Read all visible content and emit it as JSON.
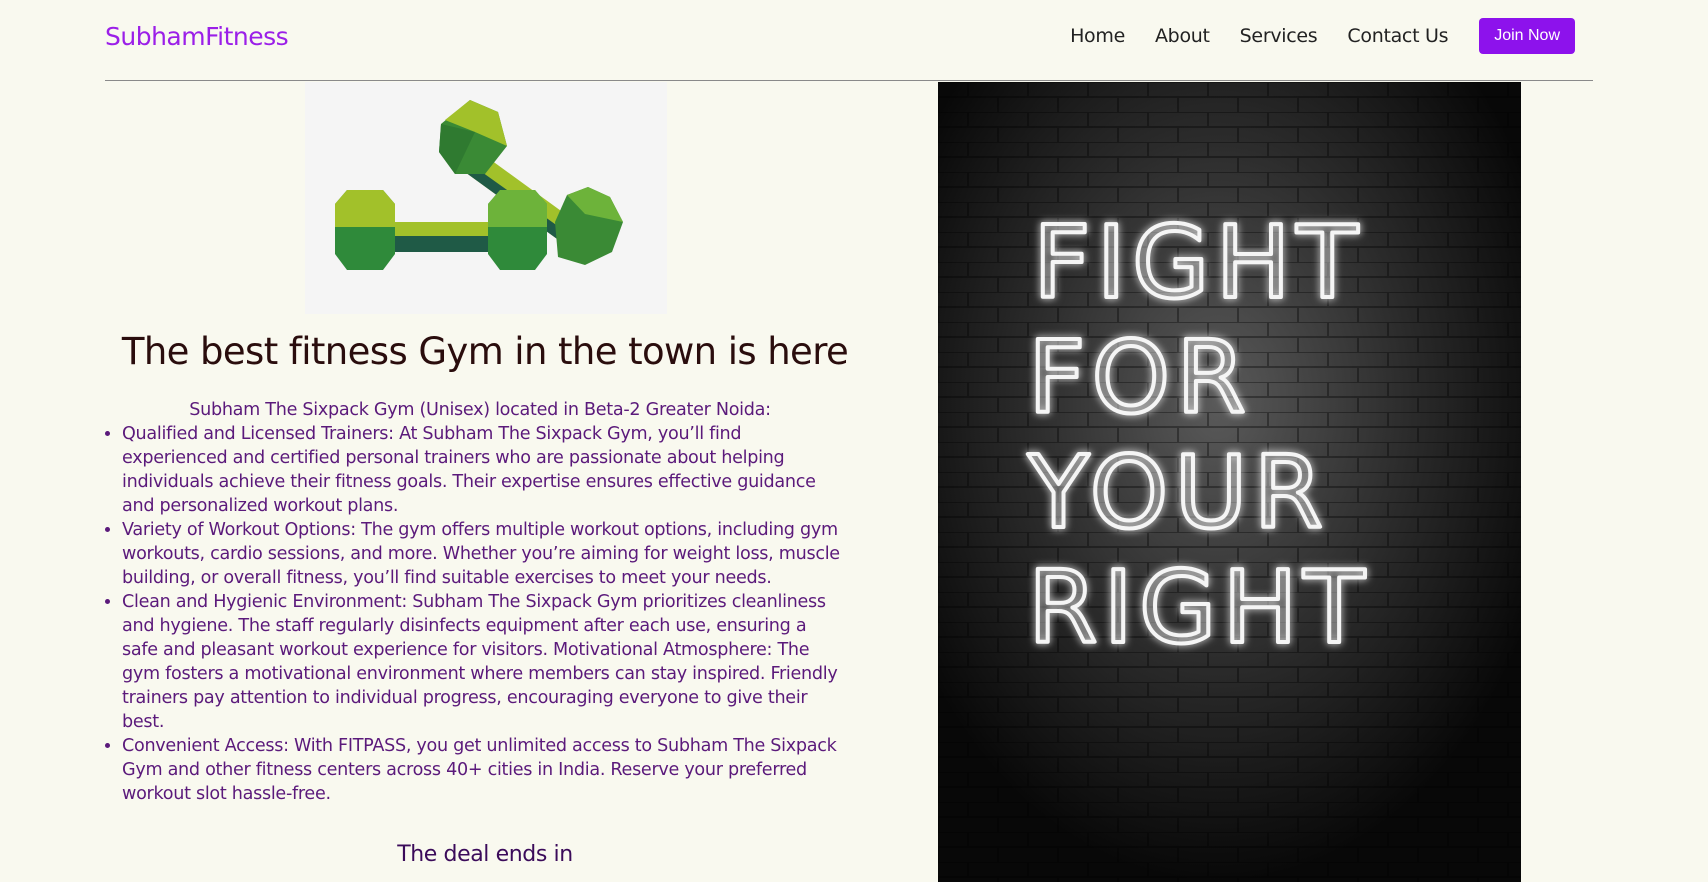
{
  "header": {
    "brand": "SubhamFitness",
    "nav": [
      "Home",
      "About",
      "Services",
      "Contact Us"
    ],
    "join_label": "Join Now"
  },
  "hero": {
    "title": "The best fitness Gym in the town is here",
    "intro": "Subham The Sixpack Gym (Unisex) located in Beta-2 Greater Noida:",
    "items": [
      "Qualified and Licensed Trainers: At Subham The Sixpack Gym, you’ll find experienced and certified personal trainers who are passionate about helping individuals achieve their fitness goals. Their expertise ensures effective guidance and personalized workout plans.",
      "Variety of Workout Options: The gym offers multiple workout options, including gym workouts, cardio sessions, and more. Whether you’re aiming for weight loss, muscle building, or overall fitness, you’ll find suitable exercises to meet your needs.",
      "Clean and Hygienic Environment: Subham The Sixpack Gym prioritizes cleanliness and hygiene. The staff regularly disinfects equipment after each use, ensuring a safe and pleasant workout experience for visitors. Motivational Atmosphere: The gym fosters a motivational environment where members can stay inspired. Friendly trainers pay attention to individual progress, encouraging everyone to give their best.",
      "Convenient Access: With FITPASS, you get unlimited access to Subham The Sixpack Gym and other fitness centers across 40+ cities in India. Reserve your preferred workout slot hassle-free."
    ],
    "deal_heading": "The deal ends in"
  },
  "poster": {
    "lines": [
      "FIGHT",
      "FOR",
      "YOUR",
      "RIGHT"
    ]
  },
  "colors": {
    "background": "#f9f9ef",
    "brand": "#9b1fe8",
    "button": "#8d12ec",
    "body_text": "#5b1a7b"
  }
}
